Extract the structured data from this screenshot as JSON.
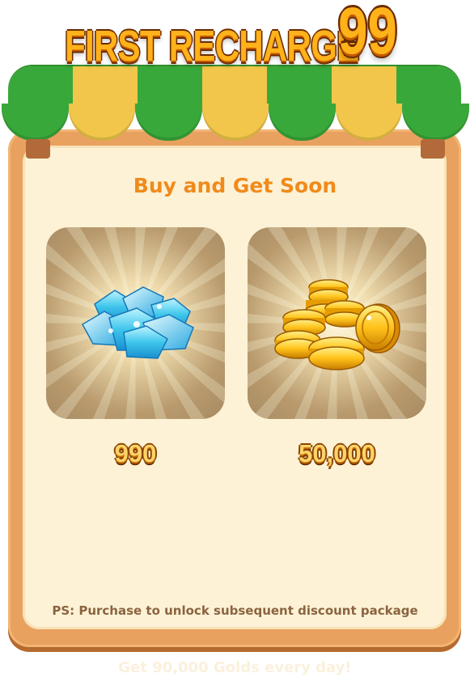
{
  "title": {
    "text": "FIRST RECHARGE",
    "number": "99"
  },
  "subtitle": "Buy and Get Soon",
  "rewards": [
    {
      "icon": "diamonds-icon",
      "amount": "990"
    },
    {
      "icon": "gold-coins-icon",
      "amount": "50,000"
    }
  ],
  "ps_note": "PS: Purchase to unlock subsequent discount package",
  "bottom_note": "Get 90,000 Golds every day!",
  "colors": {
    "awning_green": "#39a83a",
    "awning_yellow": "#f1c64a",
    "board": "#e9a15f",
    "panel": "#fdf2d6",
    "subtitle": "#f18a1b",
    "title_gold": "#ffb21a"
  }
}
